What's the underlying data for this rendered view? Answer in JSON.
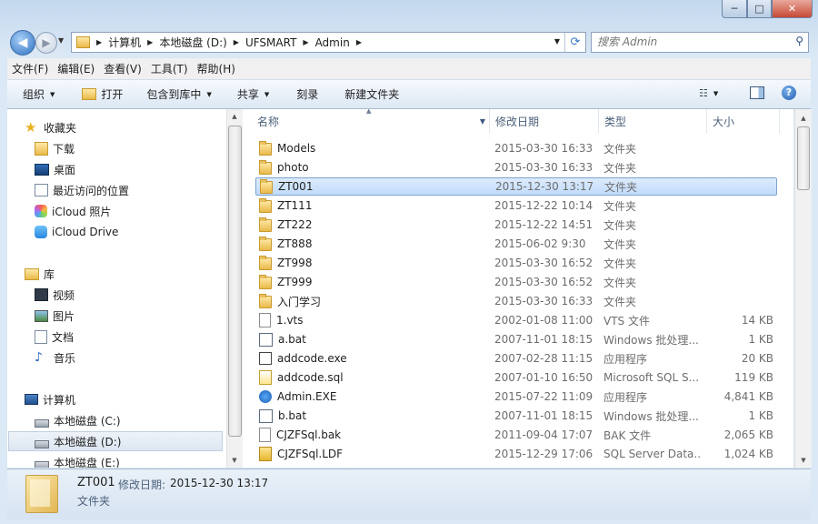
{
  "window": {
    "caption_min": "─",
    "caption_max": "□",
    "caption_close": "✕"
  },
  "address": {
    "crumbs": [
      "计算机",
      "本地磁盘 (D:)",
      "UFSMART",
      "Admin"
    ],
    "search_placeholder": "搜索 Admin"
  },
  "menubar": [
    "文件(F)",
    "编辑(E)",
    "查看(V)",
    "工具(T)",
    "帮助(H)"
  ],
  "toolbar": {
    "organize": "组织",
    "open": "打开",
    "include_in_library": "包含到库中",
    "share": "共享",
    "burn": "刻录",
    "new_folder": "新建文件夹"
  },
  "nav": {
    "favorites": {
      "label": "收藏夹",
      "items": [
        "下载",
        "桌面",
        "最近访问的位置",
        "iCloud 照片",
        "iCloud Drive"
      ]
    },
    "libraries": {
      "label": "库",
      "items": [
        "视频",
        "图片",
        "文档",
        "音乐"
      ]
    },
    "computer": {
      "label": "计算机",
      "items": [
        "本地磁盘 (C:)",
        "本地磁盘 (D:)",
        "本地磁盘 (E:)"
      ]
    }
  },
  "columns": {
    "name": "名称",
    "date": "修改日期",
    "type": "类型",
    "size": "大小"
  },
  "files": [
    {
      "name": "Models",
      "date": "2015-03-30 16:33",
      "type": "文件夹",
      "size": "",
      "icon": "folder"
    },
    {
      "name": "photo",
      "date": "2015-03-30 16:33",
      "type": "文件夹",
      "size": "",
      "icon": "folder"
    },
    {
      "name": "ZT001",
      "date": "2015-12-30 13:17",
      "type": "文件夹",
      "size": "",
      "icon": "folder"
    },
    {
      "name": "ZT111",
      "date": "2015-12-22 10:14",
      "type": "文件夹",
      "size": "",
      "icon": "folder"
    },
    {
      "name": "ZT222",
      "date": "2015-12-22 14:51",
      "type": "文件夹",
      "size": "",
      "icon": "folder"
    },
    {
      "name": "ZT888",
      "date": "2015-06-02 9:30",
      "type": "文件夹",
      "size": "",
      "icon": "folder"
    },
    {
      "name": "ZT998",
      "date": "2015-03-30 16:52",
      "type": "文件夹",
      "size": "",
      "icon": "folder"
    },
    {
      "name": "ZT999",
      "date": "2015-03-30 16:52",
      "type": "文件夹",
      "size": "",
      "icon": "folder"
    },
    {
      "name": "入门学习",
      "date": "2015-03-30 16:33",
      "type": "文件夹",
      "size": "",
      "icon": "folder"
    },
    {
      "name": "1.vts",
      "date": "2002-01-08 11:00",
      "type": "VTS 文件",
      "size": "14 KB",
      "icon": "document"
    },
    {
      "name": "a.bat",
      "date": "2007-11-01 18:15",
      "type": "Windows 批处理...",
      "size": "1 KB",
      "icon": "batch"
    },
    {
      "name": "addcode.exe",
      "date": "2007-02-28 11:15",
      "type": "应用程序",
      "size": "20 KB",
      "icon": "exe"
    },
    {
      "name": "addcode.sql",
      "date": "2007-01-10 16:50",
      "type": "Microsoft SQL S...",
      "size": "119 KB",
      "icon": "sql"
    },
    {
      "name": "Admin.EXE",
      "date": "2015-07-22 11:09",
      "type": "应用程序",
      "size": "4,841 KB",
      "icon": "admin-exe"
    },
    {
      "name": "b.bat",
      "date": "2007-11-01 18:15",
      "type": "Windows 批处理...",
      "size": "1 KB",
      "icon": "batch"
    },
    {
      "name": "CJZFSql.bak",
      "date": "2011-09-04 17:07",
      "type": "BAK 文件",
      "size": "2,065 KB",
      "icon": "document"
    },
    {
      "name": "CJZFSql.LDF",
      "date": "2015-12-29 17:06",
      "type": "SQL Server Data...",
      "size": "1,024 KB",
      "icon": "ldf"
    }
  ],
  "selected_index": 2,
  "details": {
    "name": "ZT001",
    "date_label": "修改日期:",
    "date": "2015-12-30 13:17",
    "type": "文件夹"
  }
}
